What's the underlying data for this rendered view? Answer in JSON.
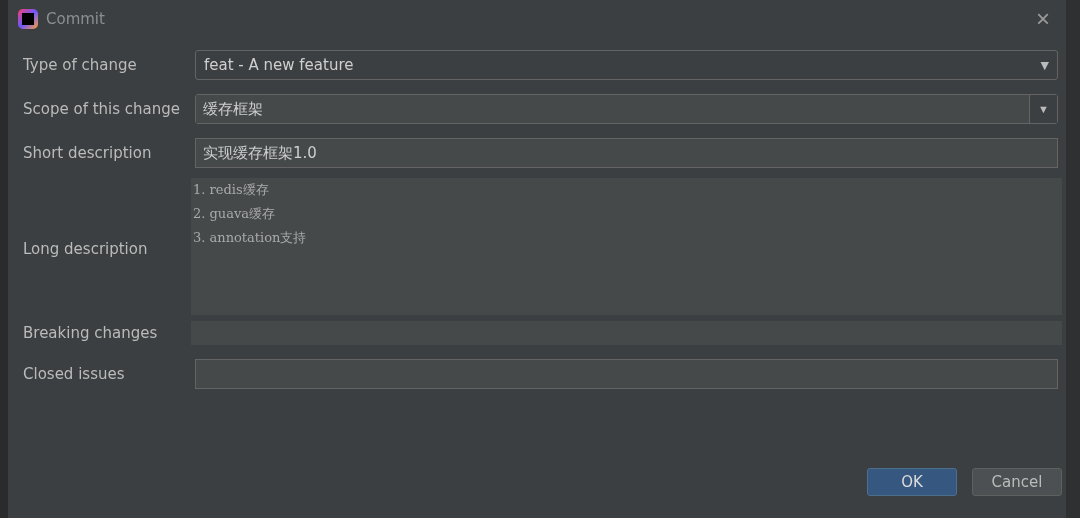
{
  "window": {
    "title": "Commit",
    "close": "×"
  },
  "fields": [
    {
      "label": "Type of change",
      "kind": "combo",
      "value": "feat - A new feature",
      "arrow": "▼"
    },
    {
      "label": "Scope of this change",
      "kind": "editable-combo",
      "value": "缓存框架",
      "arrow": "▼"
    },
    {
      "label": "Short description",
      "kind": "text",
      "value": "实现缓存框架1.0"
    },
    {
      "label": "Long description",
      "kind": "textarea",
      "lines": [
        "1. redis缓存",
        "2. guava缓存",
        "3. annotation支持"
      ]
    },
    {
      "label": "Breaking changes",
      "kind": "flat-text"
    },
    {
      "label": "Closed issues",
      "kind": "text"
    }
  ],
  "buttons": [
    {
      "label": "OK",
      "default": true
    },
    {
      "label": "Cancel",
      "default": false
    }
  ]
}
